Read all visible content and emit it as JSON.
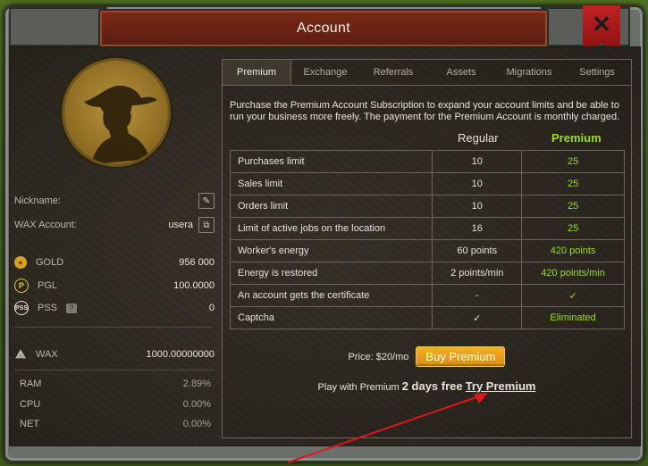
{
  "window": {
    "title": "Account"
  },
  "profile": {
    "nickname_label": "Nickname:",
    "wax_account_label": "WAX Account:",
    "wax_account_value": "usera"
  },
  "balances": {
    "gold": {
      "label": "GOLD",
      "value": "956 000"
    },
    "pgl": {
      "label": "PGL",
      "value": "100.0000"
    },
    "pss": {
      "label": "PSS",
      "value": "0",
      "help": "?"
    },
    "wax": {
      "label": "WAX",
      "value": "1000.00000000"
    }
  },
  "resources": {
    "ram": {
      "label": "RAM",
      "value": "2.89%"
    },
    "cpu": {
      "label": "CPU",
      "value": "0.00%"
    },
    "net": {
      "label": "NET",
      "value": "0.00%"
    }
  },
  "tabs": [
    "Premium",
    "Exchange",
    "Referrals",
    "Assets",
    "Migrations",
    "Settings"
  ],
  "premium": {
    "description": "Purchase the Premium Account Subscription to expand your account limits and be able to run your business more freely. The payment for the Premium Account is monthly charged.",
    "col_regular": "Regular",
    "col_premium": "Premium",
    "rows": [
      {
        "feature": "Purchases limit",
        "regular": "10",
        "premium": "25"
      },
      {
        "feature": "Sales limit",
        "regular": "10",
        "premium": "25"
      },
      {
        "feature": "Orders limit",
        "regular": "10",
        "premium": "25"
      },
      {
        "feature": "Limit of active jobs on the location",
        "regular": "16",
        "premium": "25"
      },
      {
        "feature": "Worker's energy",
        "regular": "60 points",
        "premium": "420 points"
      },
      {
        "feature": "Energy is restored",
        "regular": "2 points/min",
        "premium": "420 points/min"
      },
      {
        "feature": "An account gets the certificate",
        "regular": "-",
        "premium": "✓"
      },
      {
        "feature": "Captcha",
        "regular": "✓",
        "premium": "Eliminated"
      }
    ],
    "price": "Price: $20/mo",
    "buy_label": "Buy Premium",
    "trial_prefix": "Play with Premium",
    "trial_days": "2 days free",
    "try_label": "Try Premium"
  }
}
